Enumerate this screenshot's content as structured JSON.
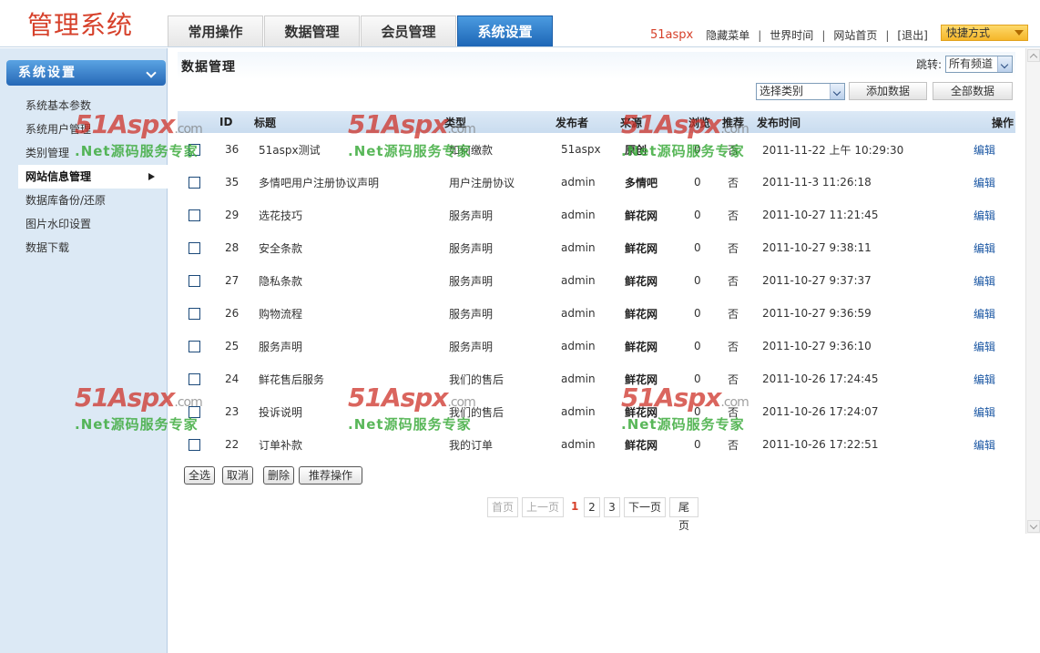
{
  "app": {
    "logo": "管理系统",
    "nav_tabs": [
      "常用操作",
      "数据管理",
      "会员管理",
      "系统设置"
    ],
    "active_tab": "系统设置"
  },
  "top_links": {
    "brand": "51aspx",
    "links": [
      "隐藏菜单",
      "世界时间",
      "网站首页",
      "[退出]"
    ],
    "quick_menu": "快捷方式"
  },
  "sidebar": {
    "header": "系统设置",
    "items": [
      "系统基本参数",
      "系统用户管理",
      "类别管理",
      "网站信息管理",
      "数据库备份/还原",
      "图片水印设置",
      "数据下载"
    ],
    "active_item": "网站信息管理"
  },
  "main": {
    "title": "数据管理",
    "jump_label": "跳转:",
    "jump_value": "所有频道",
    "category_select": "选择类别",
    "add_button": "添加数据",
    "all_button": "全部数据",
    "columns": [
      "ID",
      "标题",
      "类型",
      "发布者",
      "来源",
      "浏览",
      "推荐",
      "发布时间",
      "操作"
    ],
    "rows": [
      {
        "id": "36",
        "title": "51aspx测试",
        "type": "如何缴款",
        "publisher": "51aspx",
        "source": "原创",
        "views": "0",
        "recommend": "否",
        "time": "2011-11-22 上午 10:29:30",
        "action": "编辑"
      },
      {
        "id": "35",
        "title": "多情吧用户注册协议声明",
        "type": "用户注册协议",
        "publisher": "admin",
        "source": "多情吧",
        "views": "0",
        "recommend": "否",
        "time": "2011-11-3 11:26:18",
        "action": "编辑"
      },
      {
        "id": "29",
        "title": "选花技巧",
        "type": "服务声明",
        "publisher": "admin",
        "source": "鲜花网",
        "views": "0",
        "recommend": "否",
        "time": "2011-10-27 11:21:45",
        "action": "编辑"
      },
      {
        "id": "28",
        "title": "安全条款",
        "type": "服务声明",
        "publisher": "admin",
        "source": "鲜花网",
        "views": "0",
        "recommend": "否",
        "time": "2011-10-27 9:38:11",
        "action": "编辑"
      },
      {
        "id": "27",
        "title": "隐私条款",
        "type": "服务声明",
        "publisher": "admin",
        "source": "鲜花网",
        "views": "0",
        "recommend": "否",
        "time": "2011-10-27 9:37:37",
        "action": "编辑"
      },
      {
        "id": "26",
        "title": "购物流程",
        "type": "服务声明",
        "publisher": "admin",
        "source": "鲜花网",
        "views": "0",
        "recommend": "否",
        "time": "2011-10-27 9:36:59",
        "action": "编辑"
      },
      {
        "id": "25",
        "title": "服务声明",
        "type": "服务声明",
        "publisher": "admin",
        "source": "鲜花网",
        "views": "0",
        "recommend": "否",
        "time": "2011-10-27 9:36:10",
        "action": "编辑"
      },
      {
        "id": "24",
        "title": "鲜花售后服务",
        "type": "我们的售后",
        "publisher": "admin",
        "source": "鲜花网",
        "views": "0",
        "recommend": "否",
        "time": "2011-10-26 17:24:45",
        "action": "编辑"
      },
      {
        "id": "23",
        "title": "投诉说明",
        "type": "我们的售后",
        "publisher": "admin",
        "source": "鲜花网",
        "views": "0",
        "recommend": "否",
        "time": "2011-10-26 17:24:07",
        "action": "编辑"
      },
      {
        "id": "22",
        "title": "订单补款",
        "type": "我的订单",
        "publisher": "admin",
        "source": "鲜花网",
        "views": "0",
        "recommend": "否",
        "time": "2011-10-26 17:22:51",
        "action": "编辑"
      }
    ],
    "bulk_buttons": [
      "全选",
      "取消",
      "删除",
      "推荐操作"
    ],
    "pager": {
      "first": "首页",
      "prev": "上一页",
      "pages": [
        "1",
        "2",
        "3"
      ],
      "current": "1",
      "next": "下一页",
      "last": "尾页"
    }
  },
  "watermark": {
    "brand": "51Aspx",
    "domain": ".com",
    "slogan": ".Net源码服务专家"
  },
  "colors": {
    "logo_red": "#d6402a",
    "active_tab_blue": "#1d66b6",
    "sidebar_bg": "#dce9f5",
    "link_blue": "#1b57a3",
    "quick_menu_orange": "#f5b62a"
  }
}
